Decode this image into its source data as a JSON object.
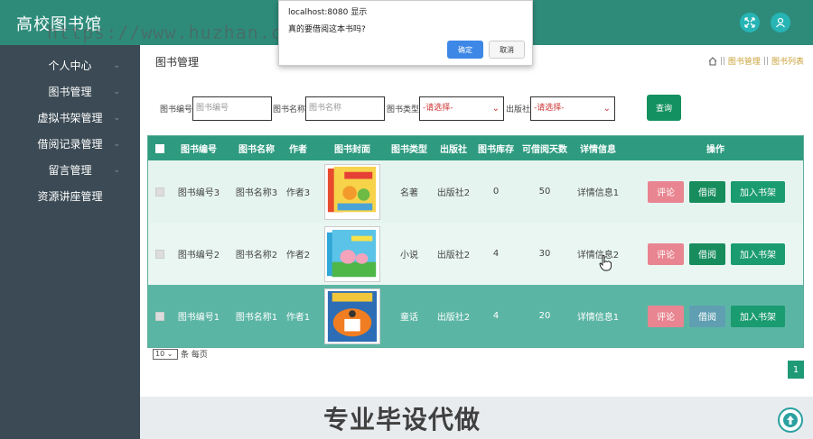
{
  "header": {
    "title": "高校图书馆"
  },
  "sidebar": {
    "items": [
      {
        "label": "个人中心",
        "arrow": "⌄"
      },
      {
        "label": "图书管理",
        "arrow": "⌄"
      },
      {
        "label": "虚拟书架管理",
        "arrow": "⌄"
      },
      {
        "label": "借阅记录管理",
        "arrow": "⌄"
      },
      {
        "label": "留言管理",
        "arrow": "⌄"
      },
      {
        "label": "资源讲座管理",
        "arrow": ""
      }
    ]
  },
  "main": {
    "page_title": "图书管理",
    "breadcrumb": {
      "sep": "||",
      "items": [
        "图书管理",
        "图书列表"
      ]
    }
  },
  "search": {
    "fields": [
      {
        "label": "图书编号",
        "placeholder": "图书编号"
      },
      {
        "label": "图书名称",
        "placeholder": "图书名称"
      }
    ],
    "selects": [
      {
        "label": "图书类型",
        "value": "-请选择-"
      },
      {
        "label": "出版社",
        "value": "-请选择-"
      }
    ],
    "query_label": "查询"
  },
  "table": {
    "columns": [
      "图书编号",
      "图书名称",
      "作者",
      "图书封面",
      "图书类型",
      "出版社",
      "图书库存",
      "可借阅天数",
      "详情信息",
      "操作"
    ],
    "rows": [
      {
        "id": "图书编号3",
        "name": "图书名称3",
        "author": "作者3",
        "type": "名著",
        "publisher": "出版社2",
        "stock": "0",
        "days": "50",
        "detail": "详情信息1"
      },
      {
        "id": "图书编号2",
        "name": "图书名称2",
        "author": "作者2",
        "type": "小说",
        "publisher": "出版社2",
        "stock": "4",
        "days": "30",
        "detail": "详情信息2"
      },
      {
        "id": "图书编号1",
        "name": "图书名称1",
        "author": "作者1",
        "type": "童话",
        "publisher": "出版社2",
        "stock": "4",
        "days": "20",
        "detail": "详情信息1"
      }
    ],
    "actions": {
      "comment": "评论",
      "borrow": "借阅",
      "shelf": "加入书架"
    }
  },
  "pager": {
    "page_size": "10",
    "suffix": "条 每页",
    "current_page": "1"
  },
  "footer": {
    "slogan": "专业毕设代做"
  },
  "dialog": {
    "host": "localhost:8080 显示",
    "message": "真的要借阅这本书吗?",
    "ok_label": "确定",
    "cancel_label": "取消"
  },
  "watermark": "https://www.huzhan.com/1shop39397",
  "colors": {
    "header": "#2e8b7a",
    "sidebar": "#3b4a54",
    "accent": "#139160"
  }
}
